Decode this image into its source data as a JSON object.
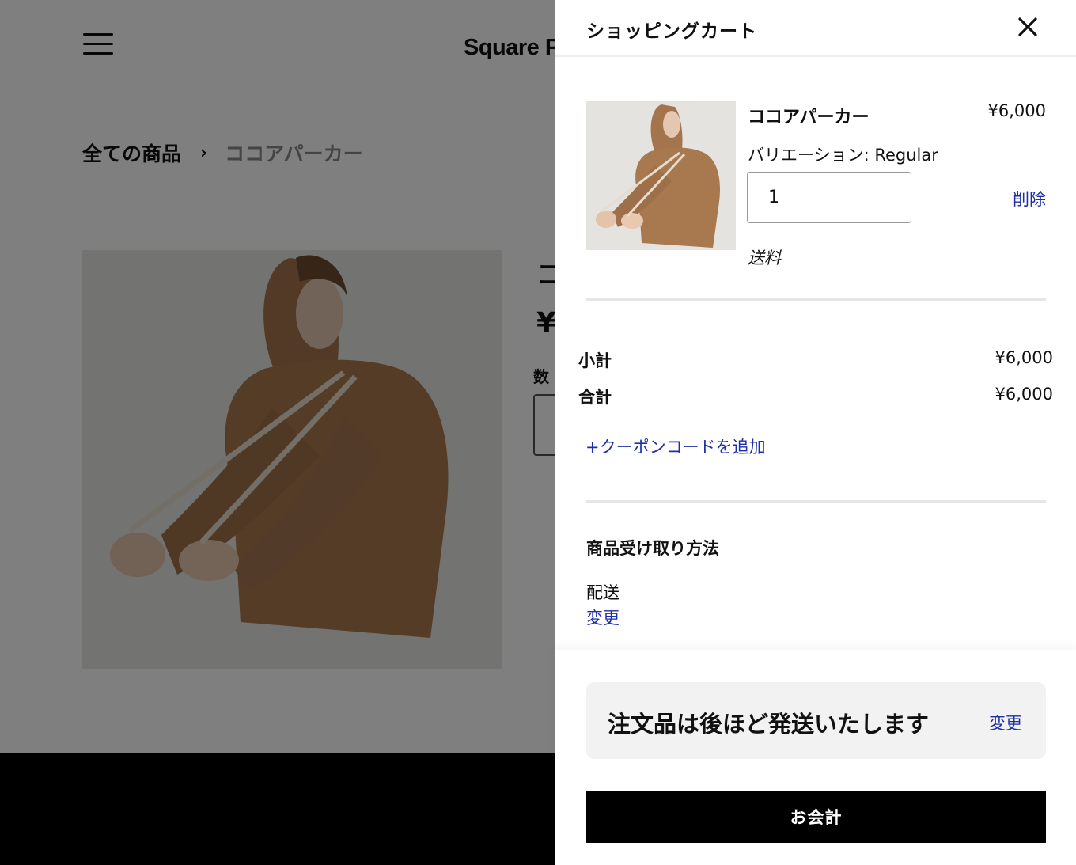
{
  "store": {
    "logo_text": "Square P",
    "breadcrumb": {
      "all_products": "全ての商品",
      "separator": "›",
      "current": "ココアパーカー"
    },
    "product_peek": {
      "title_fragment": "コ",
      "price_fragment": "¥",
      "qty_label_fragment": "数"
    }
  },
  "cart": {
    "title": "ショッピングカート",
    "close_icon": "close-icon",
    "item": {
      "name": "ココアパーカー",
      "price": "¥6,000",
      "variation": "バリエーション: Regular",
      "quantity": "1",
      "remove_label": "削除",
      "shipping_label": "送料"
    },
    "summary": {
      "subtotal_label": "小計",
      "subtotal_value": "¥6,000",
      "total_label": "合計",
      "total_value": "¥6,000",
      "coupon_link": "+クーポンコードを追加"
    },
    "fulfillment": {
      "heading": "商品受け取り方法",
      "method": "配送",
      "change_label": "変更"
    },
    "notice": {
      "text": "注文品は後ほど発送いたします",
      "change_label": "変更"
    },
    "checkout_label": "お会計"
  },
  "colors": {
    "link": "#1e2fa6",
    "checkout_bg": "#000000",
    "overlay": "rgba(0,0,0,0.5)"
  }
}
